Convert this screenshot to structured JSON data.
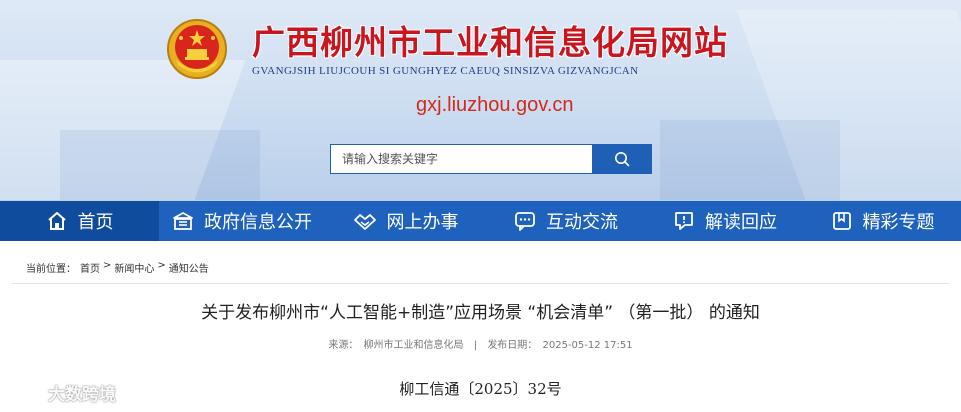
{
  "header": {
    "site_title": "广西柳州市工业和信息化局网站",
    "site_subtitle": "GVANGJSIH LIUJCOUH SI GUNGHYEZ CAEUQ SINSIZVA GIZVANGJCAN",
    "domain": "gxj.liuzhou.gov.cn",
    "emblem_icon": "national-emblem",
    "search": {
      "placeholder": "请输入搜索关键字",
      "icon": "search-icon"
    }
  },
  "nav": {
    "items": [
      {
        "label": "首页",
        "icon": "home-icon",
        "active": true
      },
      {
        "label": "政府信息公开",
        "icon": "building-icon"
      },
      {
        "label": "网上办事",
        "icon": "handshake-icon"
      },
      {
        "label": "互动交流",
        "icon": "chat-icon"
      },
      {
        "label": "解读回应",
        "icon": "message-icon"
      },
      {
        "label": "精彩专题",
        "icon": "bookmark-icon"
      }
    ]
  },
  "breadcrumb": {
    "label": "当前位置：",
    "items": [
      "首页",
      "新闻中心",
      "通知公告"
    ],
    "separator": ">"
  },
  "article": {
    "title": "关于发布柳州市“人工智能+制造”应用场景 “机会清单” （第一批） 的通知",
    "source_label": "来源：",
    "source": "柳州市工业和信息化局",
    "date_label": "发布日期：",
    "date": "2025-05-12 17:51",
    "doc_number": "柳工信通〔2025〕32号"
  },
  "watermark": {
    "text": "大数跨境",
    "icon": "logo-icon"
  },
  "colors": {
    "nav_bg": "#1e62bd",
    "nav_active": "#0f4c9e",
    "title_red": "#c9151e",
    "accent_blue": "#1f5fb5"
  }
}
